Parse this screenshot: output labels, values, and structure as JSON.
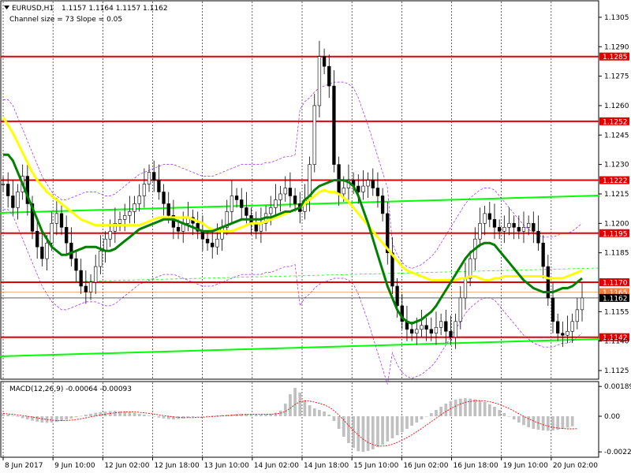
{
  "header": {
    "symbol": "EURUSD,H1",
    "ohlc": "1.1157 1.1164 1.1157 1.1162",
    "channel": "Channel size = 73 Slope = 0.05"
  },
  "macd": {
    "label": "MACD(12,26,9) -0.00064 -0.00093"
  },
  "colors": {
    "level": "#e00000",
    "sma_fast": "#ffff00",
    "sma_slow": "#008000",
    "channel": "#00ff00",
    "envelope": "#a020f0",
    "candle": "#000000",
    "histogram": "#c0c0c0",
    "signal": "#ff0000"
  },
  "chart_data": [
    {
      "type": "candlestick",
      "title": "EURUSD,H1",
      "y_ticks": [
        "1.1305",
        "1.1290",
        "1.1275",
        "1.1260",
        "1.1245",
        "1.1230",
        "1.1215",
        "1.1200",
        "1.1185",
        "1.1155",
        "1.1140",
        "1.1125"
      ],
      "levels": [
        {
          "label": "1.1285",
          "value": 1.1285
        },
        {
          "label": "1.1252",
          "value": 1.1252
        },
        {
          "label": "1.1222",
          "value": 1.1222
        },
        {
          "label": "1.1195",
          "value": 1.1195
        },
        {
          "label": "1.1170",
          "value": 1.117
        },
        {
          "label": "1.1142",
          "value": 1.1142
        }
      ],
      "extra_price_labels": [
        {
          "label": "1.1165",
          "value": 1.1165
        },
        {
          "label": "1.1162",
          "value": 1.1162
        }
      ],
      "x_labels": [
        "8 Jun 2017",
        "9 Jun 10:00",
        "12 Jun 02:00",
        "12 Jun 18:00",
        "13 Jun 10:00",
        "14 Jun 02:00",
        "14 Jun 18:00",
        "15 Jun 10:00",
        "16 Jun 02:00",
        "16 Jun 18:00",
        "19 Jun 10:00",
        "20 Jun 02:00"
      ],
      "close": [
        1.122,
        1.1214,
        1.1208,
        1.1216,
        1.1224,
        1.121,
        1.1196,
        1.1188,
        1.1182,
        1.119,
        1.12,
        1.1205,
        1.1198,
        1.119,
        1.1182,
        1.1176,
        1.1168,
        1.1165,
        1.117,
        1.1178,
        1.1186,
        1.1192,
        1.1196,
        1.12,
        1.1202,
        1.1204,
        1.1206,
        1.121,
        1.1214,
        1.122,
        1.1226,
        1.1222,
        1.1216,
        1.121,
        1.1204,
        1.1198,
        1.1196,
        1.12,
        1.1203,
        1.12,
        1.1196,
        1.1192,
        1.119,
        1.1188,
        1.1192,
        1.1198,
        1.1206,
        1.1214,
        1.1212,
        1.1208,
        1.1204,
        1.12,
        1.1196,
        1.12,
        1.1205,
        1.1208,
        1.1212,
        1.1215,
        1.1218,
        1.1214,
        1.121,
        1.1206,
        1.1212,
        1.123,
        1.126,
        1.1285,
        1.128,
        1.127,
        1.123,
        1.1215,
        1.1218,
        1.1222,
        1.1219,
        1.1216,
        1.1219,
        1.1222,
        1.1218,
        1.1214,
        1.1205,
        1.1185,
        1.1168,
        1.1158,
        1.115,
        1.1146,
        1.1144,
        1.1146,
        1.1148,
        1.1146,
        1.1144,
        1.1147,
        1.115,
        1.1145,
        1.1142,
        1.115,
        1.1162,
        1.1172,
        1.1182,
        1.1192,
        1.12,
        1.1205,
        1.1202,
        1.1198,
        1.1196,
        1.1198,
        1.12,
        1.1198,
        1.1196,
        1.1198,
        1.12,
        1.1196,
        1.119,
        1.1178,
        1.1162,
        1.115,
        1.1144,
        1.1143,
        1.1145,
        1.115,
        1.1156,
        1.1162
      ],
      "sma_fast": [
        1.1254,
        1.125,
        1.1246,
        1.1241,
        1.1236,
        1.1231,
        1.1226,
        1.1222,
        1.1219,
        1.1216,
        1.1214,
        1.1212,
        1.121,
        1.1208,
        1.1206,
        1.1204,
        1.1202,
        1.1201,
        1.12,
        1.1199,
        1.1199,
        1.1199,
        1.1199,
        1.1199,
        1.1199,
        1.1199,
        1.1199,
        1.1199,
        1.1199,
        1.12,
        1.1201,
        1.1202,
        1.1203,
        1.1203,
        1.1203,
        1.1203,
        1.1203,
        1.1203,
        1.1203,
        1.1202,
        1.1201,
        1.12,
        1.1198,
        1.1197,
        1.1196,
        1.1196,
        1.1196,
        1.1196,
        1.1197,
        1.1198,
        1.1199,
        1.12,
        1.12,
        1.12,
        1.1201,
        1.1202,
        1.1203,
        1.1204,
        1.1205,
        1.1206,
        1.1207,
        1.1208,
        1.121,
        1.1212,
        1.1214,
        1.1216,
        1.1217,
        1.1216,
        1.1216,
        1.1215,
        1.1213,
        1.1211,
        1.1208,
        1.1205,
        1.1202,
        1.1199,
        1.1196,
        1.1193,
        1.119,
        1.1187,
        1.1184,
        1.1181,
        1.1178,
        1.1176,
        1.1175,
        1.1174,
        1.1173,
        1.1172,
        1.1171,
        1.1171,
        1.1171,
        1.1171,
        1.1171,
        1.1171,
        1.1172,
        1.1172,
        1.1173,
        1.1173,
        1.1172,
        1.1171,
        1.1171,
        1.1172,
        1.1172,
        1.1173,
        1.1173,
        1.1173,
        1.1173,
        1.1173,
        1.1173,
        1.1173,
        1.1173,
        1.1173,
        1.1172,
        1.1172,
        1.1172,
        1.1172,
        1.1173,
        1.1174,
        1.1175,
        1.1176
      ],
      "sma_slow": [
        1.1235,
        1.1235,
        1.1232,
        1.1226,
        1.122,
        1.1214,
        1.1208,
        1.1202,
        1.1196,
        1.1192,
        1.1188,
        1.1186,
        1.1184,
        1.1184,
        1.1185,
        1.1186,
        1.1187,
        1.1188,
        1.1188,
        1.1188,
        1.1187,
        1.1186,
        1.1186,
        1.1187,
        1.1189,
        1.1191,
        1.1193,
        1.1195,
        1.1197,
        1.1198,
        1.1199,
        1.12,
        1.1201,
        1.1202,
        1.1202,
        1.1202,
        1.1201,
        1.12,
        1.1199,
        1.1198,
        1.1197,
        1.1196,
        1.1196,
        1.1196,
        1.1197,
        1.1198,
        1.1199,
        1.12,
        1.1201,
        1.1202,
        1.1202,
        1.1202,
        1.1202,
        1.1202,
        1.1203,
        1.1203,
        1.1204,
        1.1205,
        1.1206,
        1.1206,
        1.1207,
        1.1208,
        1.1212,
        1.1214,
        1.1217,
        1.1219,
        1.122,
        1.1221,
        1.1222,
        1.1222,
        1.1222,
        1.1221,
        1.1219,
        1.1214,
        1.1207,
        1.12,
        1.1192,
        1.1184,
        1.1176,
        1.1168,
        1.1162,
        1.1156,
        1.1152,
        1.115,
        1.1149,
        1.115,
        1.1151,
        1.1153,
        1.1155,
        1.1158,
        1.1162,
        1.1166,
        1.117,
        1.1174,
        1.1178,
        1.1182,
        1.1185,
        1.1187,
        1.1189,
        1.119,
        1.119,
        1.1189,
        1.1186,
        1.1183,
        1.118,
        1.1177,
        1.1174,
        1.1171,
        1.1169,
        1.1167,
        1.1166,
        1.1165,
        1.1165,
        1.1165,
        1.1166,
        1.1167,
        1.1167,
        1.1168,
        1.117,
        1.1172
      ],
      "ylim": [
        1.1121,
        1.1313
      ]
    },
    {
      "type": "bar",
      "title": "MACD(12,26,9)",
      "y_ticks": [
        "0.00189",
        "0.00",
        "-0.00226"
      ],
      "ylim": [
        -0.0025,
        0.0021
      ],
      "histogram": [
        0.0002,
        0.00012,
        4e-05,
        -4e-05,
        -0.00012,
        -0.0002,
        -0.00028,
        -0.00034,
        -0.0004,
        -0.00042,
        -0.0004,
        -0.00036,
        -0.0003,
        -0.00022,
        -0.00014,
        -6e-05,
        2e-05,
        0.0001,
        0.00016,
        0.00022,
        0.00026,
        0.0003,
        0.00032,
        0.00034,
        0.00032,
        0.0003,
        0.00026,
        0.00022,
        0.00016,
        0.0001,
        4e-05,
        -2e-05,
        -8e-05,
        -0.00014,
        -0.00018,
        -0.0002,
        -0.00018,
        -0.00014,
        -0.0001,
        -6e-05,
        -2e-05,
        0.0,
        2e-05,
        4e-05,
        6e-05,
        8e-05,
        0.0001,
        0.00012,
        0.00014,
        0.00016,
        0.00016,
        0.00014,
        0.00012,
        0.0001,
        0.00012,
        0.00016,
        0.00022,
        0.00036,
        0.0008,
        0.0014,
        0.0018,
        0.0015,
        0.001,
        0.0007,
        0.0005,
        0.0004,
        0.0003,
        0.0001,
        -0.0003,
        -0.0008,
        -0.0013,
        -0.0017,
        -0.002,
        -0.00222,
        -0.00226,
        -0.0022,
        -0.0021,
        -0.00196,
        -0.0018,
        -0.0016,
        -0.0014,
        -0.0012,
        -0.001,
        -0.0008,
        -0.0006,
        -0.0004,
        -0.0002,
        0.0,
        0.0002,
        0.0004,
        0.0006,
        0.0008,
        0.00096,
        0.00106,
        0.00112,
        0.00114,
        0.00112,
        0.00108,
        0.001,
        0.0009,
        0.00076,
        0.0006,
        0.0004,
        0.0002,
        0.0,
        -0.0002,
        -0.0004,
        -0.00056,
        -0.0007,
        -0.0008,
        -0.00086,
        -0.0009,
        -0.00092,
        -0.0009,
        -0.00086,
        -0.0008,
        -0.00072,
        -0.00064
      ],
      "signal": [
        0.00018,
        0.00015,
        0.00012,
        8e-05,
        4e-05,
        0.0,
        -5e-05,
        -0.0001,
        -0.00016,
        -0.00021,
        -0.00025,
        -0.00027,
        -0.00028,
        -0.00027,
        -0.00025,
        -0.00021,
        -0.00016,
        -0.0001,
        -4e-05,
        2e-05,
        8e-05,
        0.00013,
        0.00018,
        0.00022,
        0.00025,
        0.00027,
        0.00028,
        0.00027,
        0.00025,
        0.00022,
        0.00018,
        0.00014,
        9e-05,
        4e-05,
        0.0,
        -4e-05,
        -7e-05,
        -9e-05,
        -9e-05,
        -9e-05,
        -7e-05,
        -6e-05,
        -4e-05,
        -2e-05,
        0.0,
        2e-05,
        4e-05,
        6e-05,
        8e-05,
        0.0001,
        0.00011,
        0.00012,
        0.00012,
        0.00012,
        0.00012,
        0.00013,
        0.00015,
        0.00019,
        0.0003,
        0.0005,
        0.00075,
        0.00092,
        0.00098,
        0.00096,
        0.0009,
        0.00082,
        0.00072,
        0.00058,
        0.00036,
        8e-05,
        -0.00024,
        -0.00058,
        -0.0009,
        -0.0012,
        -0.00146,
        -0.00166,
        -0.0018,
        -0.00188,
        -0.0019,
        -0.00186,
        -0.00178,
        -0.00166,
        -0.00152,
        -0.00136,
        -0.00118,
        -0.00098,
        -0.00078,
        -0.00056,
        -0.00034,
        -0.00012,
        0.0001,
        0.0003,
        0.00048,
        0.00064,
        0.00078,
        0.00088,
        0.00094,
        0.00098,
        0.00099,
        0.00097,
        0.00092,
        0.00085,
        0.00075,
        0.00063,
        0.00049,
        0.00033,
        0.00016,
        0.0,
        -0.00016,
        -0.0003,
        -0.00043,
        -0.00054,
        -0.00063,
        -0.0007,
        -0.00075,
        -0.00078,
        -0.0008,
        -0.0008,
        -0.00079
      ]
    }
  ]
}
